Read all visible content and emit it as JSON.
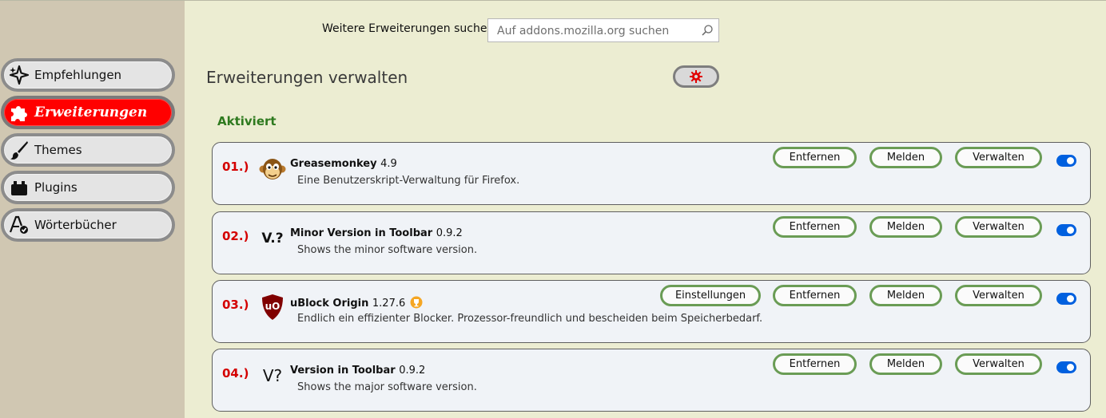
{
  "search": {
    "label": "Weitere Erweiterungen suchen",
    "placeholder": "Auf addons.mozilla.org suchen"
  },
  "sidebar": {
    "items": [
      {
        "label": "Empfehlungen",
        "icon": "sparkle-icon",
        "active": false
      },
      {
        "label": "Erweiterungen",
        "icon": "puzzle-icon",
        "active": true
      },
      {
        "label": "Themes",
        "icon": "brush-icon",
        "active": false
      },
      {
        "label": "Plugins",
        "icon": "plugin-block-icon",
        "active": false
      },
      {
        "label": "Wörterbücher",
        "icon": "dictionary-icon",
        "active": false
      }
    ]
  },
  "main": {
    "heading": "Erweiterungen verwalten",
    "gear_icon": "gear-icon",
    "section_label": "Aktiviert",
    "buttons": {
      "remove": "Entfernen",
      "report": "Melden",
      "manage": "Verwalten",
      "prefs": "Einstellungen"
    },
    "addons": [
      {
        "num": "01.)",
        "name": "Greasemonkey",
        "version": "4.9",
        "description": "Eine Benutzerskript-Verwaltung für Firefox.",
        "icon": "monkey-icon",
        "enabled": true
      },
      {
        "num": "02.)",
        "name": "Minor Version in Toolbar",
        "version": "0.9.2",
        "description": "Shows the minor software version.",
        "icon_text": "V.?",
        "enabled": true
      },
      {
        "num": "03.)",
        "name": "uBlock Origin",
        "version": "1.27.6",
        "description": "Endlich ein effizienter Blocker. Prozessor-freundlich und bescheiden beim Speicherbedarf.",
        "icon_text": "uO",
        "recommended_badge": "trophy-icon",
        "enabled": true
      },
      {
        "num": "04.)",
        "name": "Version in Toolbar",
        "version": "0.9.2",
        "description": "Shows the major software version.",
        "icon_text": "V?",
        "enabled": true
      }
    ]
  },
  "colors": {
    "accent_red": "#ff0000",
    "number_red": "#d40000",
    "section_green": "#2e7a1f",
    "toggle_blue": "#0060df",
    "button_border_green": "#6a9c55"
  }
}
